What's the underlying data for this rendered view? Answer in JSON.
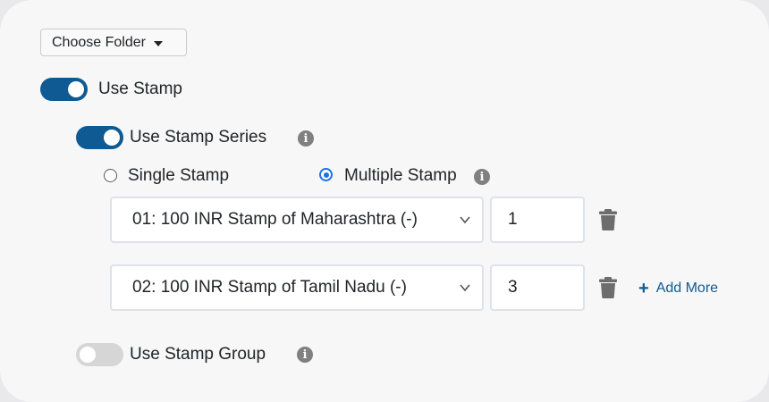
{
  "choose_folder": {
    "label": "Choose Folder",
    "icon": "caret-down-icon"
  },
  "use_stamp": {
    "label": "Use Stamp",
    "enabled": true
  },
  "stamp_series": {
    "label": "Use Stamp Series",
    "enabled": true,
    "info_icon": "i",
    "mode_options": [
      {
        "label": "Single Stamp",
        "selected": false
      },
      {
        "label": "Multiple Stamp",
        "selected": true
      }
    ],
    "multiple_info_icon": "i",
    "rows": [
      {
        "stamp": "01: 100 INR Stamp of Maharashtra (-)",
        "quantity": "1"
      },
      {
        "stamp": "02: 100 INR Stamp of Tamil Nadu (-)",
        "quantity": "3"
      }
    ],
    "add_more_label": "Add More"
  },
  "stamp_group": {
    "label": "Use Stamp Group",
    "enabled": false,
    "info_icon": "i"
  },
  "colors": {
    "accent": "#0f5a93",
    "radio_accent": "#1a73e8",
    "icon_gray": "#808080"
  }
}
